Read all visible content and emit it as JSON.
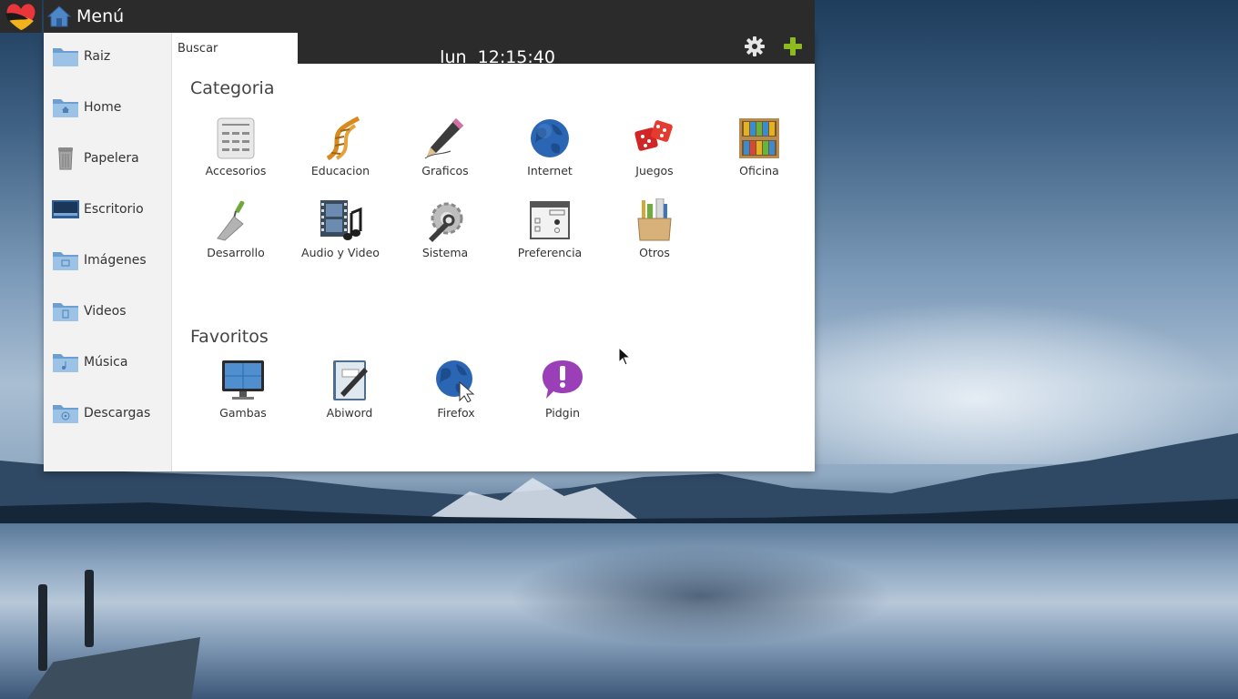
{
  "menu": {
    "title": "Menú",
    "clock": {
      "day": "lun",
      "time": "12:15:40"
    },
    "search": {
      "placeholder": "Buscar"
    }
  },
  "sidebar": {
    "items": [
      {
        "label": "Raiz",
        "icon": "folder-icon"
      },
      {
        "label": "Home",
        "icon": "home-folder-icon"
      },
      {
        "label": "Papelera",
        "icon": "trash-icon"
      },
      {
        "label": "Escritorio",
        "icon": "desktop-icon"
      },
      {
        "label": "Imágenes",
        "icon": "pictures-folder-icon"
      },
      {
        "label": "Videos",
        "icon": "videos-folder-icon"
      },
      {
        "label": "Música",
        "icon": "music-folder-icon"
      },
      {
        "label": "Descargas",
        "icon": "downloads-folder-icon"
      }
    ]
  },
  "categories": {
    "title": "Categoria",
    "items": [
      {
        "label": "Accesorios",
        "icon": "calculator-icon"
      },
      {
        "label": "Educacion",
        "icon": "dna-icon"
      },
      {
        "label": "Graficos",
        "icon": "pencil-icon"
      },
      {
        "label": "Internet",
        "icon": "globe-icon"
      },
      {
        "label": "Juegos",
        "icon": "dice-icon"
      },
      {
        "label": "Oficina",
        "icon": "binders-icon"
      },
      {
        "label": "Desarrollo",
        "icon": "trowel-icon"
      },
      {
        "label": "Audio y Video",
        "icon": "film-music-icon"
      },
      {
        "label": "Sistema",
        "icon": "gear-wrench-icon"
      },
      {
        "label": "Preferencia",
        "icon": "preferences-window-icon"
      },
      {
        "label": "Otros",
        "icon": "toolbox-icon"
      }
    ]
  },
  "favorites": {
    "title": "Favoritos",
    "items": [
      {
        "label": "Gambas",
        "icon": "monitor-icon"
      },
      {
        "label": "Abiword",
        "icon": "notebook-pen-icon"
      },
      {
        "label": "Firefox",
        "icon": "globe-cursor-icon"
      },
      {
        "label": "Pidgin",
        "icon": "chat-bubble-icon"
      }
    ]
  },
  "colors": {
    "panel_bg": "#ffffff",
    "bar_bg": "#2b2b2b",
    "sidebar_bg": "#f2f2f2",
    "accent_green": "#8dbb1f"
  }
}
